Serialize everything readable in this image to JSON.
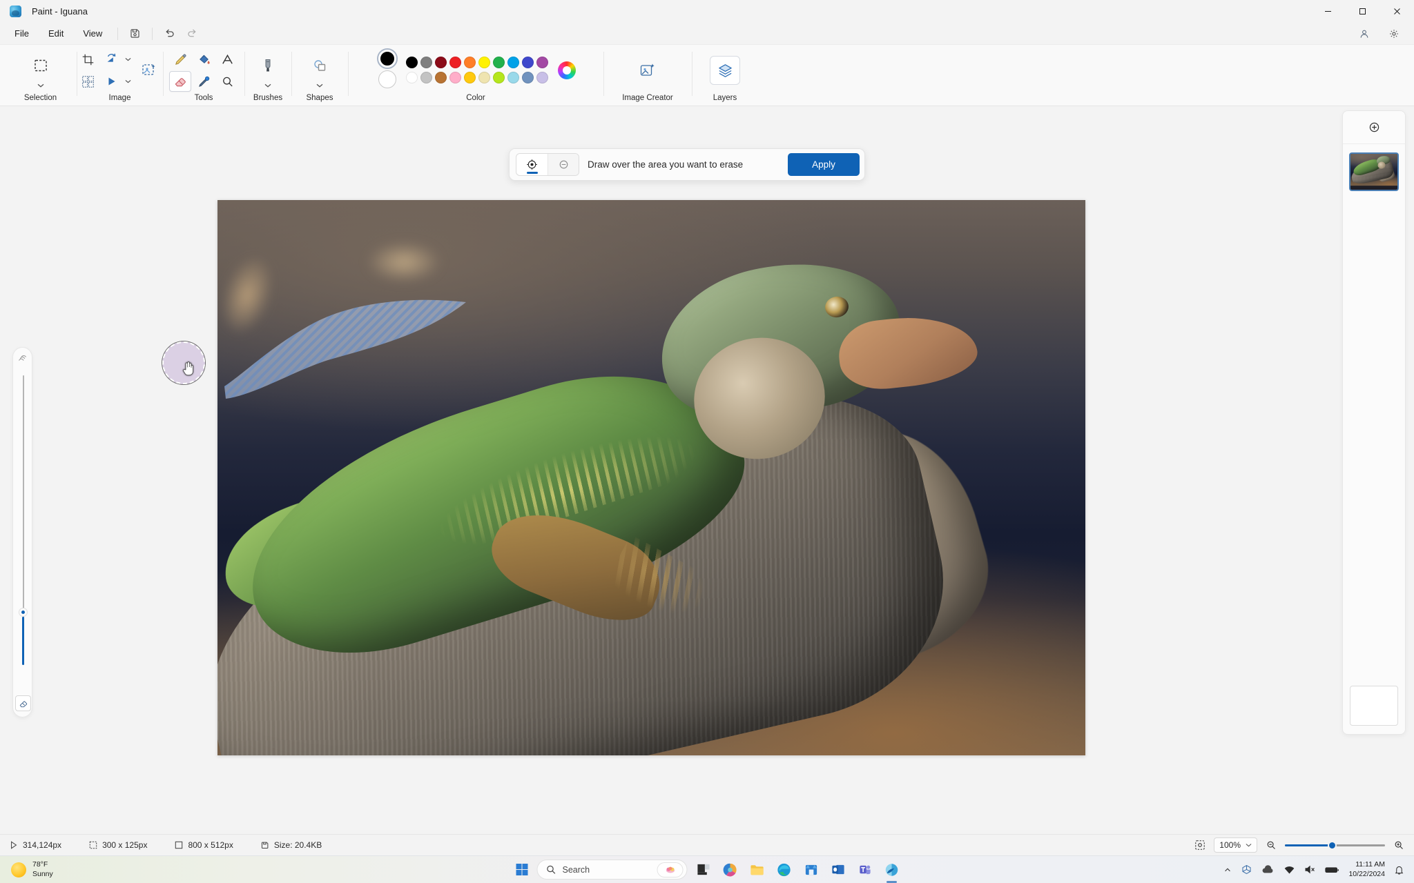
{
  "window": {
    "title": "Paint - Iguana",
    "app_icon": "paint-app-icon",
    "minimize": "−",
    "maximize": "☐",
    "close": "✕"
  },
  "menubar": {
    "items": [
      {
        "label": "File"
      },
      {
        "label": "Edit"
      },
      {
        "label": "View"
      }
    ],
    "icon_buttons": [
      {
        "name": "save-icon"
      },
      {
        "name": "undo-icon"
      },
      {
        "name": "redo-icon"
      }
    ],
    "right_tools": [
      {
        "name": "account-icon"
      },
      {
        "name": "settings-gear-icon"
      }
    ]
  },
  "ribbon": {
    "groups": [
      {
        "label": "Selection"
      },
      {
        "label": "Image"
      },
      {
        "label": "Tools"
      },
      {
        "label": "Brushes"
      },
      {
        "label": "Shapes"
      },
      {
        "label": "Color"
      },
      {
        "label": "Image Creator"
      },
      {
        "label": "Layers"
      }
    ]
  },
  "color": {
    "primary": "#000000",
    "secondary": "#ffffff",
    "row1": [
      "#000000",
      "#7f7f7f",
      "#8b0b18",
      "#ed2024",
      "#ff7e27",
      "#fff200",
      "#22b14c",
      "#00a2e8",
      "#3f48cc",
      "#a349a4"
    ],
    "row2": [
      "#ffffff",
      "#c3c3c3",
      "#b87333",
      "#ffaec9",
      "#ffc90e",
      "#efe4b0",
      "#b5e61d",
      "#99d9ea",
      "#7092be",
      "#c8bfe7"
    ],
    "row3": [
      "#ffffff",
      "#ffffff",
      "#ffffff",
      "#ffffff",
      "#ffffff",
      "#ffffff",
      "#ffffff",
      "#ffffff",
      "#ffffff",
      "#ffffff"
    ],
    "wheel": "color-wheel-icon"
  },
  "eraser_popup": {
    "add_mode": "add-to-selection-icon",
    "subtract_mode": "subtract-from-selection-icon",
    "instruction": "Draw over the area you want to erase",
    "apply_label": "Apply"
  },
  "brush_size_panel": {
    "icon": "brush-size-icon",
    "reset_icon": "eraser-reset-icon"
  },
  "layers_panel": {
    "add_label": "add-layer-icon",
    "layers": [
      {
        "name": "layer-1-thumbnail",
        "selected": true
      },
      {
        "name": "layer-2-thumbnail",
        "selected": false
      }
    ]
  },
  "statusbar": {
    "cursor_position": "314,124px",
    "selection_size": "300 x 125px",
    "image_size": "800 x 512px",
    "file_size": "Size: 20.4KB",
    "fit_icon": "fit-to-window-icon",
    "zoom_level": "100%",
    "zoom_out_icon": "zoom-out-icon",
    "zoom_in_icon": "zoom-in-icon"
  },
  "taskbar": {
    "weather": {
      "temperature": "78°F",
      "condition": "Sunny"
    },
    "start": "start-button",
    "search": {
      "placeholder": "Search",
      "value": ""
    },
    "apps": [
      {
        "name": "taskbar-app-copilot",
        "active": false
      },
      {
        "name": "taskbar-app-file-explorer",
        "active": false
      },
      {
        "name": "taskbar-app-edge",
        "active": false
      },
      {
        "name": "taskbar-app-store",
        "active": false
      },
      {
        "name": "taskbar-app-outlook",
        "active": false
      },
      {
        "name": "taskbar-app-teams",
        "active": false
      },
      {
        "name": "taskbar-app-paint",
        "active": true
      }
    ],
    "tray": {
      "chevron": "show-hidden-icons-icon",
      "onedrive": "onedrive-icon",
      "cloud": "cloud-icon",
      "network": "network-icon",
      "volume": "volume-muted-icon",
      "battery": "battery-icon",
      "time": "11:11 AM",
      "date": "10/22/2024",
      "notifications": "notification-bell-icon"
    }
  }
}
